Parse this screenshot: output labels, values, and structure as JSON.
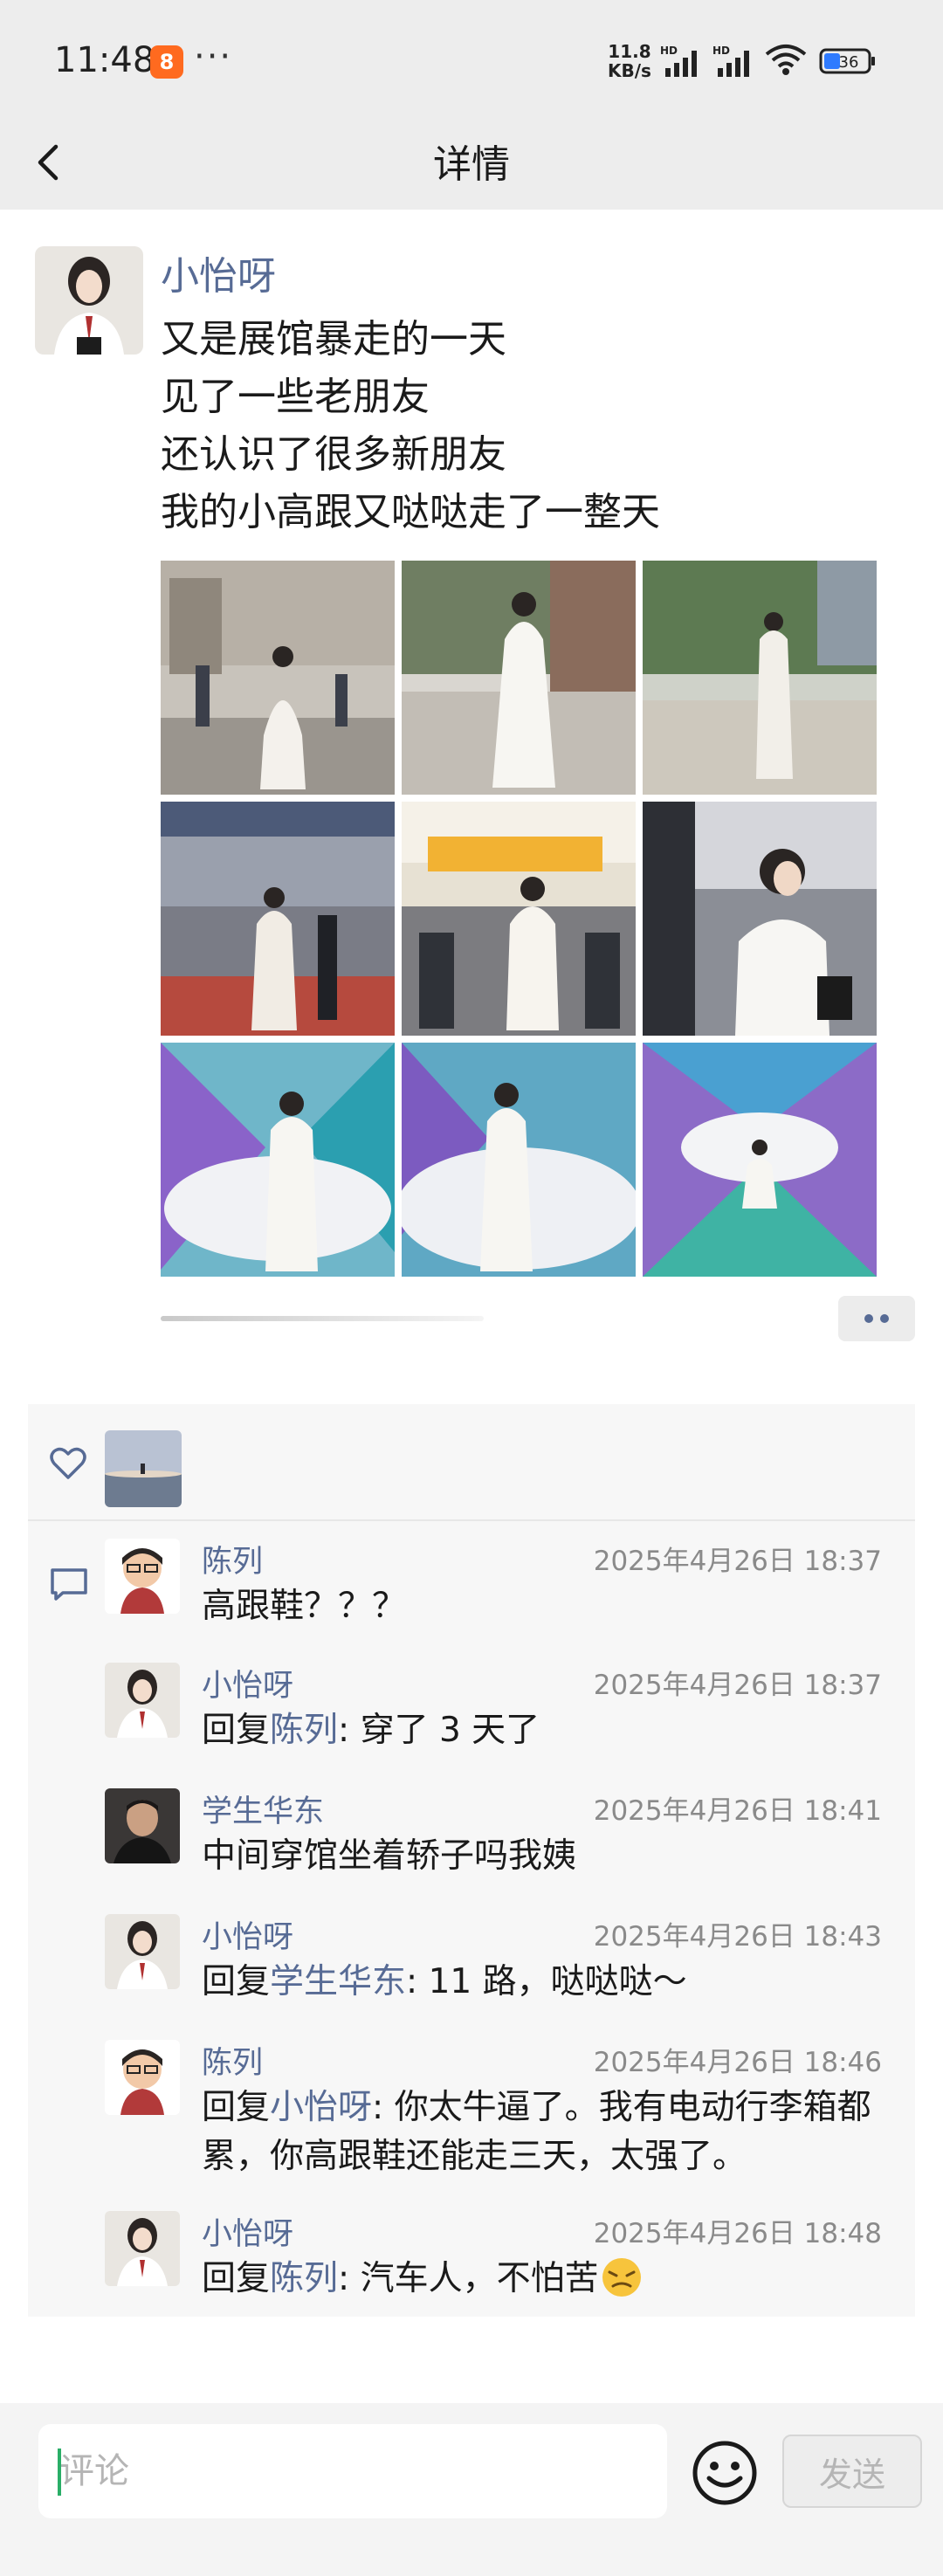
{
  "status_bar": {
    "time": "11:48",
    "app_badge": "8",
    "more": "···",
    "speed_value": "11.8",
    "speed_unit": "KB/s",
    "hd": "HD",
    "battery": "36"
  },
  "nav": {
    "title": "详情"
  },
  "post": {
    "author": "小怡呀",
    "lines": [
      "又是展馆暴走的一天",
      "见了一些老朋友",
      "还认识了很多新朋友",
      "我的小高跟又哒哒走了一整天"
    ]
  },
  "comments": [
    {
      "name": "陈列",
      "time": "2025年4月26日 18:37",
      "prefix": "",
      "reply_to": "",
      "text": "高跟鞋？？？"
    },
    {
      "name": "小怡呀",
      "time": "2025年4月26日 18:37",
      "prefix": "回复",
      "reply_to": "陈列",
      "text": ": 穿了 3 天了"
    },
    {
      "name": "学生华东",
      "time": "2025年4月26日 18:41",
      "prefix": "",
      "reply_to": "",
      "text": "中间穿馆坐着轿子吗我姨"
    },
    {
      "name": "小怡呀",
      "time": "2025年4月26日 18:43",
      "prefix": "回复",
      "reply_to": "学生华东",
      "text": ": 11 路，哒哒哒～"
    },
    {
      "name": "陈列",
      "time": "2025年4月26日 18:46",
      "prefix": "回复",
      "reply_to": "小怡呀",
      "text": ": 你太牛逼了。我有电动行李箱都累，你高跟鞋还能走三天，太强了。"
    },
    {
      "name": "小怡呀",
      "time": "2025年4月26日 18:48",
      "prefix": "回复",
      "reply_to": "陈列",
      "text": ": 汽车人，不怕苦"
    }
  ],
  "input": {
    "placeholder": "评论",
    "send_label": "发送"
  },
  "colors": {
    "link": "#576b95",
    "bar_bg": "#ededed",
    "caret": "#2aae67"
  },
  "icons": [
    "back-arrow-icon",
    "heart-icon",
    "comment-icon",
    "emoji-icon",
    "wifi-icon",
    "signal-icon",
    "battery-icon"
  ]
}
